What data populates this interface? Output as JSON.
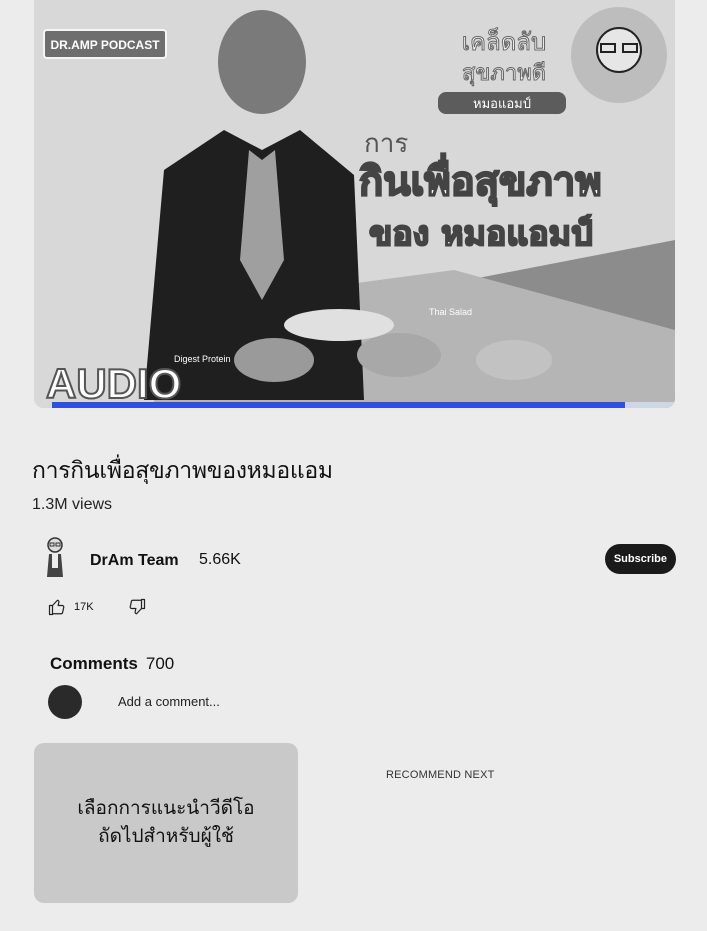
{
  "thumbnail": {
    "podcast_badge": "DR.AMP PODCAST",
    "audio_label": "AUDIO",
    "headline_1": "การ",
    "headline_2": "กินเพื่อสุขภาพ",
    "headline_3": "ของ หมอแอมป์",
    "tag_top": "เคล็ดลับ",
    "tag_mid": "สุขภาพดี",
    "tag_bottom": "หมอแอมป์",
    "caption_1": "Thai Salad",
    "caption_2": "Digest Protein",
    "progress_fraction": 0.92,
    "colors": {
      "progress": "#2f4fe0",
      "banner": "#9a9a9a"
    }
  },
  "video": {
    "title": "การกินเพื่อสุขภาพของหมอแอม",
    "views": "1.3M views"
  },
  "channel": {
    "name": "DrAm Team",
    "subscribers": "5.66K",
    "subscribe_label": "Subscribe"
  },
  "actions": {
    "like_count": "17K",
    "like_icon": "thumbs-up-icon",
    "dislike_icon": "thumbs-down-icon"
  },
  "comments": {
    "label": "Comments",
    "count": "700",
    "add_placeholder": "Add a comment..."
  },
  "recommend": {
    "card_text_1": "เลือกการแนะนำวีดีโอ",
    "card_text_2": "ถัดไปสำหรับผู้ใช้",
    "label": "RECOMMEND NEXT"
  }
}
